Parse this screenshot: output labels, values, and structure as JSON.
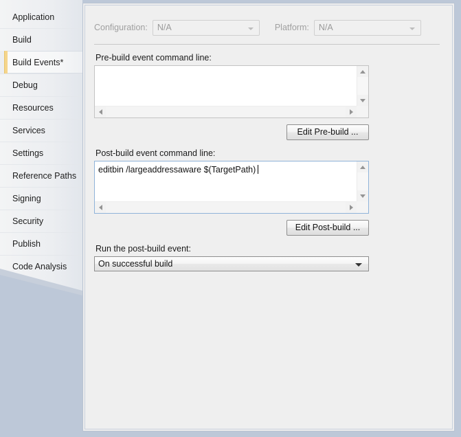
{
  "sidebar": {
    "items": [
      {
        "label": "Application",
        "selected": false
      },
      {
        "label": "Build",
        "selected": false
      },
      {
        "label": "Build Events*",
        "selected": true
      },
      {
        "label": "Debug",
        "selected": false
      },
      {
        "label": "Resources",
        "selected": false
      },
      {
        "label": "Services",
        "selected": false
      },
      {
        "label": "Settings",
        "selected": false
      },
      {
        "label": "Reference Paths",
        "selected": false
      },
      {
        "label": "Signing",
        "selected": false
      },
      {
        "label": "Security",
        "selected": false
      },
      {
        "label": "Publish",
        "selected": false
      },
      {
        "label": "Code Analysis",
        "selected": false
      }
    ]
  },
  "toolbar": {
    "configuration_label": "Configuration:",
    "configuration_value": "N/A",
    "platform_label": "Platform:",
    "platform_value": "N/A"
  },
  "prebuild": {
    "label": "Pre-build event command line:",
    "value": "",
    "button_label": "Edit Pre-build ..."
  },
  "postbuild": {
    "label": "Post-build event command line:",
    "value": "editbin /largeaddressaware $(TargetPath)",
    "button_label": "Edit Post-build ..."
  },
  "run_event": {
    "label": "Run the post-build event:",
    "value": "On successful build"
  },
  "colors": {
    "window_background": "#bdc8d8",
    "panel_background": "#efefef",
    "selection_accent": "#f5d58c",
    "focus_border": "#8fb3d9",
    "disabled_text": "#9a9a9a"
  }
}
